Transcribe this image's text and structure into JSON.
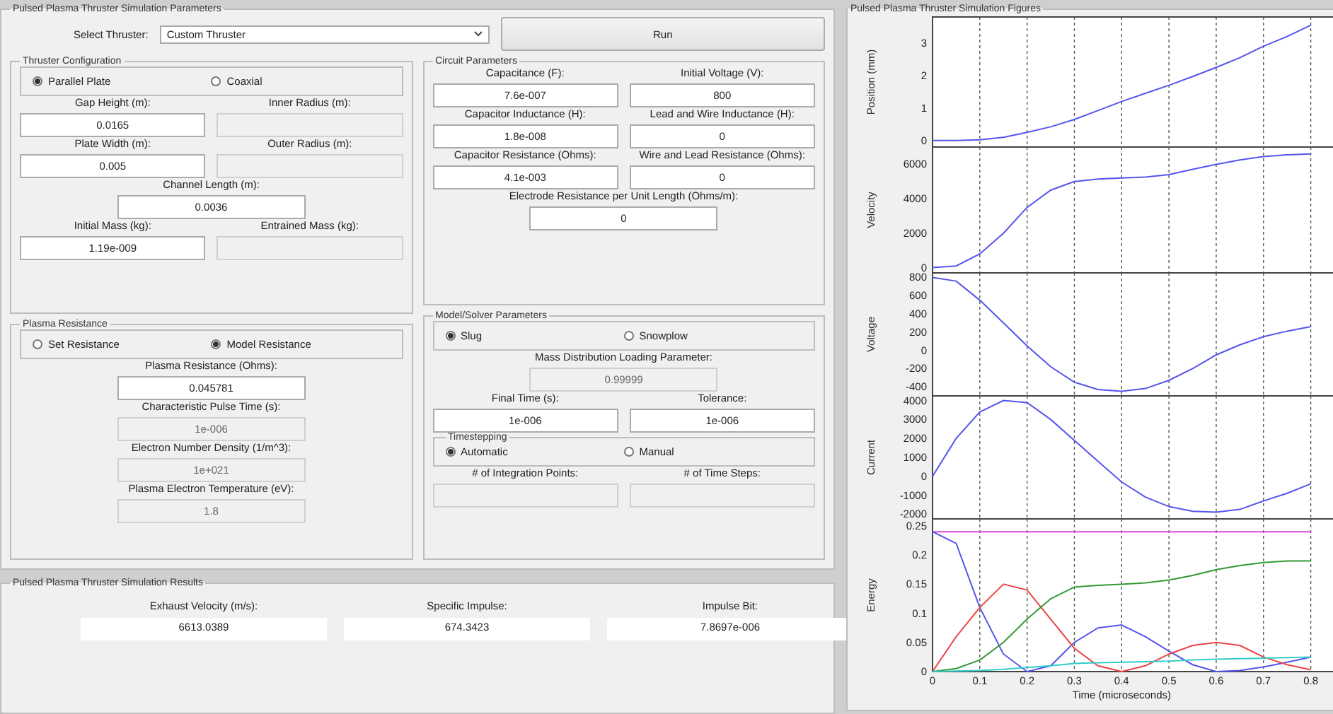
{
  "parameters_panel": {
    "title": "Pulsed Plasma Thruster Simulation Parameters",
    "select": {
      "label": "Select Thruster:",
      "value": "Custom Thruster"
    },
    "run_button": "Run",
    "left_column": [
      {
        "title": "Thruster Configuration",
        "sections": [
          {
            "kind": "options",
            "options": [
              {
                "label": "Parallel Plate",
                "selected": true
              },
              {
                "label": "Coaxial",
                "selected": false
              }
            ]
          },
          {
            "kind": "row",
            "fields": [
              {
                "label": "Gap Height (m):",
                "value": "0.0165",
                "disabled": false
              },
              {
                "label": "Inner Radius (m):",
                "disabled": true
              }
            ]
          },
          {
            "kind": "row",
            "fields": [
              {
                "label": "Plate Width (m):",
                "value": "0.005",
                "disabled": false
              },
              {
                "label": "Outer Radius (m):",
                "disabled": true
              }
            ]
          },
          {
            "kind": "row",
            "fields": [
              {
                "label": "Channel Length (m):",
                "value": "0.0036",
                "disabled": false
              }
            ]
          },
          {
            "kind": "row",
            "fields": [
              {
                "label": "Initial Mass (kg):",
                "value": "1.19e-009",
                "disabled": false
              },
              {
                "label": "Entrained Mass (kg):",
                "disabled": true
              }
            ]
          }
        ]
      },
      {
        "title": "Plasma Resistance",
        "sections": [
          {
            "kind": "options",
            "options": [
              {
                "label": "Set Resistance",
                "selected": false
              },
              {
                "label": "Model Resistance",
                "selected": true
              }
            ]
          },
          {
            "kind": "row",
            "fields": [
              {
                "label": "Plasma Resistance (Ohms):",
                "value": "0.045781",
                "disabled": false
              }
            ]
          },
          {
            "kind": "row",
            "fields": [
              {
                "label": "Characteristic Pulse Time (s):",
                "value": "1e-006",
                "disabled": true
              }
            ]
          },
          {
            "kind": "row",
            "fields": [
              {
                "label": "Electron Number Density (1/m^3):",
                "value": "1e+021",
                "disabled": true
              }
            ]
          },
          {
            "kind": "row",
            "fields": [
              {
                "label": "Plasma Electron Temperature (eV):",
                "value": "1.8",
                "disabled": true
              }
            ]
          }
        ]
      }
    ],
    "right_column": [
      {
        "title": "Circuit Parameters",
        "sections": [
          {
            "kind": "row",
            "fields": [
              {
                "label": "Capacitance (F):",
                "value": "7.6e-007",
                "disabled": false
              },
              {
                "label": "Initial Voltage (V):",
                "value": "800",
                "disabled": false
              }
            ]
          },
          {
            "kind": "row",
            "fields": [
              {
                "label": "Capacitor Inductance (H):",
                "value": "1.8e-008",
                "disabled": false
              },
              {
                "label": "Lead and Wire Inductance (H):",
                "value": "0",
                "disabled": false
              }
            ]
          },
          {
            "kind": "row",
            "fields": [
              {
                "label": "Capacitor Resistance (Ohms):",
                "value": "4.1e-003",
                "disabled": false
              },
              {
                "label": "Wire and Lead Resistance (Ohms):",
                "value": "0",
                "disabled": false
              }
            ]
          },
          {
            "kind": "row",
            "fields": [
              {
                "label": "Electrode Resistance per Unit Length (Ohms/m):",
                "value": "0",
                "disabled": false
              }
            ]
          }
        ]
      },
      {
        "title": "Model/Solver Parameters",
        "sections": [
          {
            "kind": "options",
            "options": [
              {
                "label": "Slug",
                "selected": true
              },
              {
                "label": "Snowplow",
                "selected": false
              }
            ]
          },
          {
            "kind": "row",
            "fields": [
              {
                "label": "Mass Distribution Loading Parameter:",
                "value": "0.99999",
                "disabled": true
              }
            ]
          },
          {
            "kind": "row",
            "fields": [
              {
                "label": "Final Time (s):",
                "value": "1e-006",
                "disabled": false
              },
              {
                "label": "Tolerance:",
                "value": "1e-006",
                "disabled": false
              }
            ]
          },
          {
            "kind": "subgroup",
            "title": "Timestepping",
            "options": [
              {
                "label": "Automatic",
                "selected": true
              },
              {
                "label": "Manual",
                "selected": false
              }
            ]
          },
          {
            "kind": "row",
            "fields": [
              {
                "label": "# of Integration Points:",
                "disabled": true
              },
              {
                "label": "# of Time Steps:",
                "disabled": true
              }
            ]
          }
        ]
      }
    ]
  },
  "results_panel": {
    "title": "Pulsed Plasma Thruster Simulation Results",
    "fields": [
      {
        "label": "Exhaust Velocity (m/s):",
        "value": "6613.0389"
      },
      {
        "label": "Specific Impulse:",
        "value": "674.3423"
      },
      {
        "label": "Impulse Bit:",
        "value": "7.8697e-006"
      }
    ]
  },
  "figures_panel": {
    "title": "Pulsed Plasma Thruster Simulation Figures",
    "charts": [
      {
        "chart_data": {
          "type": "line",
          "ylabel": "Position (mm)",
          "x": [
            0,
            0.05,
            0.1,
            0.15,
            0.2,
            0.25,
            0.3,
            0.35,
            0.4,
            0.45,
            0.5,
            0.55,
            0.6,
            0.65,
            0.7,
            0.75,
            0.8
          ],
          "xlim": [
            0,
            0.85
          ],
          "ylim": [
            -0.2,
            3.8
          ],
          "grid": true,
          "yticks": [
            0,
            1,
            2,
            3
          ],
          "series": [
            {
              "color": "#5555ee",
              "values": [
                0,
                0,
                0.02,
                0.1,
                0.25,
                0.42,
                0.65,
                0.92,
                1.2,
                1.45,
                1.7,
                1.97,
                2.25,
                2.55,
                2.9,
                3.2,
                3.55
              ]
            }
          ]
        }
      },
      {
        "chart_data": {
          "type": "line",
          "ylabel": "Velocity",
          "x": [
            0,
            0.05,
            0.1,
            0.15,
            0.2,
            0.25,
            0.3,
            0.35,
            0.4,
            0.45,
            0.5,
            0.55,
            0.6,
            0.65,
            0.7,
            0.75,
            0.8
          ],
          "xlim": [
            0,
            0.85
          ],
          "ylim": [
            -300,
            7000
          ],
          "grid": true,
          "yticks": [
            0,
            2000,
            4000,
            6000
          ],
          "series": [
            {
              "color": "#5555ee",
              "values": [
                0,
                100,
                800,
                2000,
                3500,
                4500,
                5000,
                5150,
                5200,
                5250,
                5400,
                5700,
                6000,
                6250,
                6450,
                6550,
                6600
              ]
            }
          ]
        }
      },
      {
        "chart_data": {
          "type": "line",
          "ylabel": "Voltage",
          "x": [
            0,
            0.05,
            0.1,
            0.15,
            0.2,
            0.25,
            0.3,
            0.35,
            0.4,
            0.45,
            0.5,
            0.55,
            0.6,
            0.65,
            0.7,
            0.75,
            0.8
          ],
          "xlim": [
            0,
            0.85
          ],
          "ylim": [
            -500,
            850
          ],
          "grid": true,
          "yticks": [
            -400,
            -200,
            0,
            200,
            400,
            600,
            800
          ],
          "series": [
            {
              "color": "#5555ee",
              "values": [
                800,
                760,
                550,
                300,
                50,
                -180,
                -350,
                -430,
                -450,
                -420,
                -330,
                -200,
                -50,
                60,
                150,
                210,
                260
              ]
            }
          ]
        }
      },
      {
        "chart_data": {
          "type": "line",
          "ylabel": "Current",
          "x": [
            0,
            0.05,
            0.1,
            0.15,
            0.2,
            0.25,
            0.3,
            0.35,
            0.4,
            0.45,
            0.5,
            0.55,
            0.6,
            0.65,
            0.7,
            0.75,
            0.8
          ],
          "xlim": [
            0,
            0.85
          ],
          "ylim": [
            -2250,
            4250
          ],
          "grid": true,
          "yticks": [
            -2000,
            -1000,
            0,
            1000,
            2000,
            3000,
            4000
          ],
          "series": [
            {
              "color": "#5555ee",
              "values": [
                0,
                2000,
                3400,
                4000,
                3900,
                3000,
                1900,
                800,
                -300,
                -1100,
                -1600,
                -1850,
                -1900,
                -1750,
                -1300,
                -900,
                -400
              ]
            }
          ]
        }
      },
      {
        "chart_data": {
          "type": "line",
          "ylabel": "Energy",
          "xlabel": "Time (microseconds)",
          "x": [
            0,
            0.05,
            0.1,
            0.15,
            0.2,
            0.25,
            0.3,
            0.35,
            0.4,
            0.45,
            0.5,
            0.55,
            0.6,
            0.65,
            0.7,
            0.75,
            0.8
          ],
          "xlim": [
            0,
            0.85
          ],
          "ylim": [
            0,
            0.262
          ],
          "grid": true,
          "xticks": [
            0,
            0.1,
            0.2,
            0.3,
            0.4,
            0.5,
            0.6,
            0.7,
            0.8
          ],
          "yticks": [
            0,
            0.05,
            0.1,
            0.15,
            0.2,
            0.25
          ],
          "series": [
            {
              "color": "#dd44dd",
              "values": [
                0.24,
                0.24,
                0.24,
                0.24,
                0.24,
                0.24,
                0.24,
                0.24,
                0.24,
                0.24,
                0.24,
                0.24,
                0.24,
                0.24,
                0.24,
                0.24,
                0.24
              ]
            },
            {
              "color": "#5555ee",
              "values": [
                0.24,
                0.22,
                0.11,
                0.03,
                0.0,
                0.01,
                0.05,
                0.075,
                0.08,
                0.06,
                0.035,
                0.012,
                0.0,
                0.002,
                0.008,
                0.016,
                0.025
              ]
            },
            {
              "color": "#ee4444",
              "values": [
                0,
                0.06,
                0.11,
                0.15,
                0.14,
                0.09,
                0.04,
                0.01,
                0,
                0.01,
                0.03,
                0.045,
                0.05,
                0.045,
                0.025,
                0.012,
                0.003
              ]
            },
            {
              "color": "#339933",
              "values": [
                0,
                0.005,
                0.02,
                0.05,
                0.09,
                0.125,
                0.145,
                0.148,
                0.15,
                0.152,
                0.157,
                0.165,
                0.175,
                0.182,
                0.187,
                0.19,
                0.19
              ]
            },
            {
              "color": "#33cccc",
              "values": [
                0,
                0.001,
                0.002,
                0.004,
                0.007,
                0.01,
                0.014,
                0.015,
                0.016,
                0.017,
                0.018,
                0.02,
                0.021,
                0.022,
                0.023,
                0.024,
                0.025
              ]
            }
          ]
        }
      }
    ]
  }
}
